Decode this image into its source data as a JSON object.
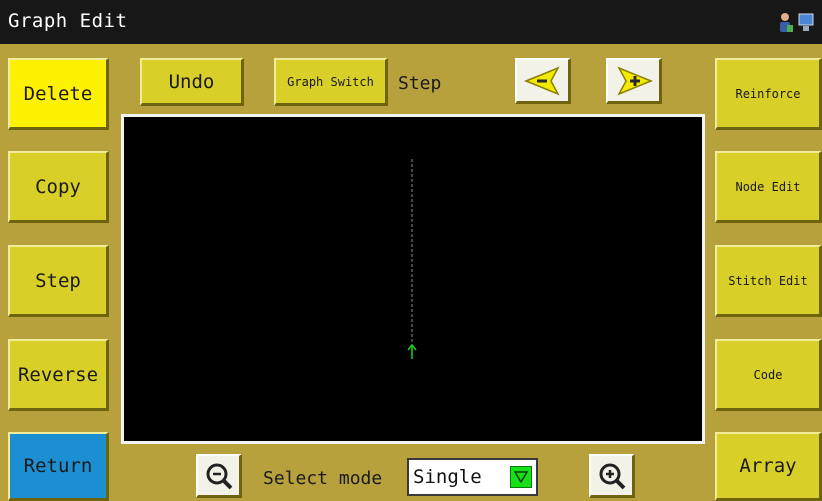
{
  "titlebar": {
    "title": "Graph Edit",
    "icons": [
      "user-icon",
      "computer-icon"
    ]
  },
  "left_buttons": {
    "delete": "Delete",
    "copy": "Copy",
    "step": "Step",
    "reverse": "Reverse",
    "return": "Return"
  },
  "top_bar": {
    "undo": "Undo",
    "graph_switch": "Graph Switch",
    "step_label": "Step",
    "step_prev_icon": "minus-arrow-icon",
    "step_next_icon": "plus-arrow-icon"
  },
  "right_buttons": {
    "reinforce": "Reinforce",
    "node_edit": "Node Edit",
    "stitch_edit": "Stitch Edit",
    "code": "Code",
    "array": "Array"
  },
  "bottom_bar": {
    "zoom_out_icon": "zoom-out-icon",
    "select_mode_label": "Select mode",
    "select_mode_value": "Single",
    "zoom_in_icon": "zoom-in-icon"
  },
  "colors": {
    "background": "#b6a13c",
    "button": "#d8cf28",
    "delete_button": "#fff200",
    "return_button": "#1c8fd2",
    "canvas": "#000000",
    "stitch_line": "#8a8a8a",
    "start_marker": "#1ed01e"
  }
}
